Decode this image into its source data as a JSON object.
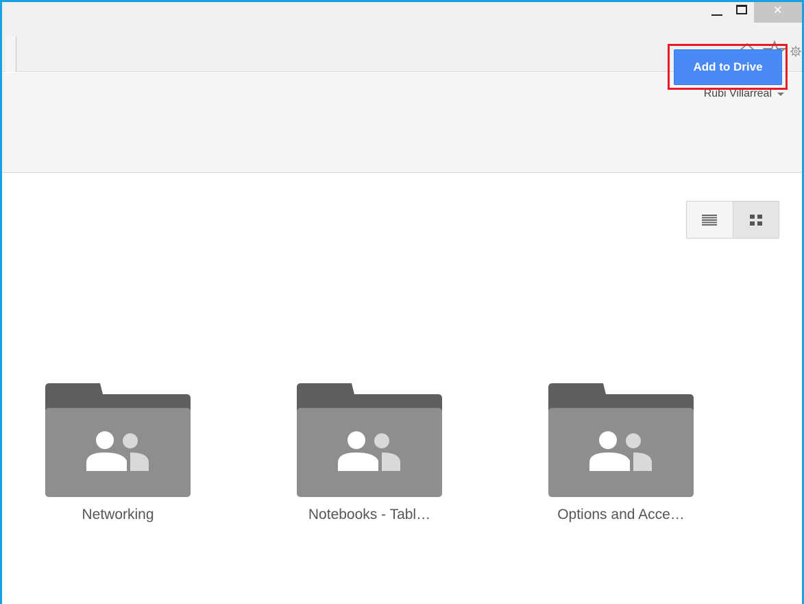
{
  "window": {
    "controls": [
      "minimize",
      "maximize",
      "close"
    ],
    "close_glyph": "✕"
  },
  "toolbar": {
    "icons": [
      "home-icon",
      "star-icon",
      "gear-icon"
    ]
  },
  "header": {
    "user_name": "Rubi Villarreal",
    "add_to_drive_label": "Add to Drive",
    "accent_color": "#4a8af4",
    "highlight_color": "#e51c23"
  },
  "view_toggle": {
    "options": [
      "list-view",
      "grid-view"
    ],
    "selected": "grid-view"
  },
  "folders": [
    {
      "name": "Networking",
      "icon": "shared-folder-icon"
    },
    {
      "name": "Notebooks - Tabl…",
      "icon": "shared-folder-icon"
    },
    {
      "name": "Options and Acce…",
      "icon": "shared-folder-icon"
    }
  ]
}
